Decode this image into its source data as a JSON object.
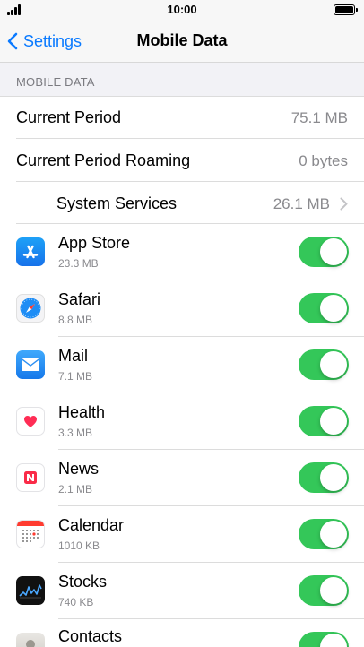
{
  "status_bar": {
    "time": "10:00"
  },
  "nav": {
    "back_label": "Settings",
    "title": "Mobile Data"
  },
  "section": {
    "header": "MOBILE DATA"
  },
  "summary_rows": [
    {
      "label": "Current Period",
      "value": "75.1 MB"
    },
    {
      "label": "Current Period Roaming",
      "value": "0 bytes"
    },
    {
      "label": "System Services",
      "value": "26.1 MB"
    }
  ],
  "apps": [
    {
      "name": "App Store",
      "size": "23.3 MB",
      "icon": "app-store-icon",
      "enabled": true
    },
    {
      "name": "Safari",
      "size": "8.8 MB",
      "icon": "safari-icon",
      "enabled": true
    },
    {
      "name": "Mail",
      "size": "7.1 MB",
      "icon": "mail-icon",
      "enabled": true
    },
    {
      "name": "Health",
      "size": "3.3 MB",
      "icon": "health-icon",
      "enabled": true
    },
    {
      "name": "News",
      "size": "2.1 MB",
      "icon": "news-icon",
      "enabled": true
    },
    {
      "name": "Calendar",
      "size": "1010 KB",
      "icon": "calendar-icon",
      "enabled": true
    },
    {
      "name": "Stocks",
      "size": "740 KB",
      "icon": "stocks-icon",
      "enabled": true
    },
    {
      "name": "Contacts",
      "size": "",
      "icon": "contacts-icon",
      "enabled": true
    }
  ],
  "colors": {
    "accent": "#0a7aff",
    "toggle_on": "#34c759",
    "secondary_text": "#8a8a8e"
  }
}
